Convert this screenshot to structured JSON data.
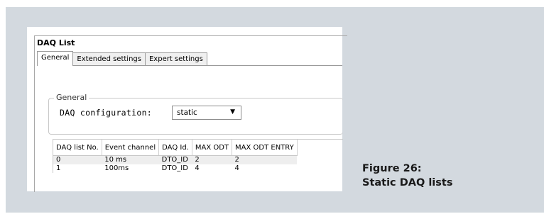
{
  "dialog": {
    "title": "DAQ List",
    "tabs": [
      {
        "label": "General",
        "active": true
      },
      {
        "label": "Extended settings",
        "active": false
      },
      {
        "label": "Expert settings",
        "active": false
      }
    ]
  },
  "general_group": {
    "label": "General",
    "daq_configuration_label": "DAQ configuration:",
    "daq_configuration_value": "static"
  },
  "table": {
    "headers": [
      "DAQ list No.",
      "Event channel",
      "DAQ Id.",
      "MAX ODT",
      "MAX ODT ENTRY"
    ],
    "rows": [
      [
        "0",
        "10 ms",
        "DTO_ID",
        "2",
        "2"
      ],
      [
        "1",
        "100ms",
        "DTO_ID",
        "4",
        "4"
      ]
    ]
  },
  "caption": {
    "line1": "Figure 26:",
    "line2": "Static DAQ lists"
  },
  "colors": {
    "panel_background": "#d3d9df",
    "alt_row": "#eeeeee"
  }
}
